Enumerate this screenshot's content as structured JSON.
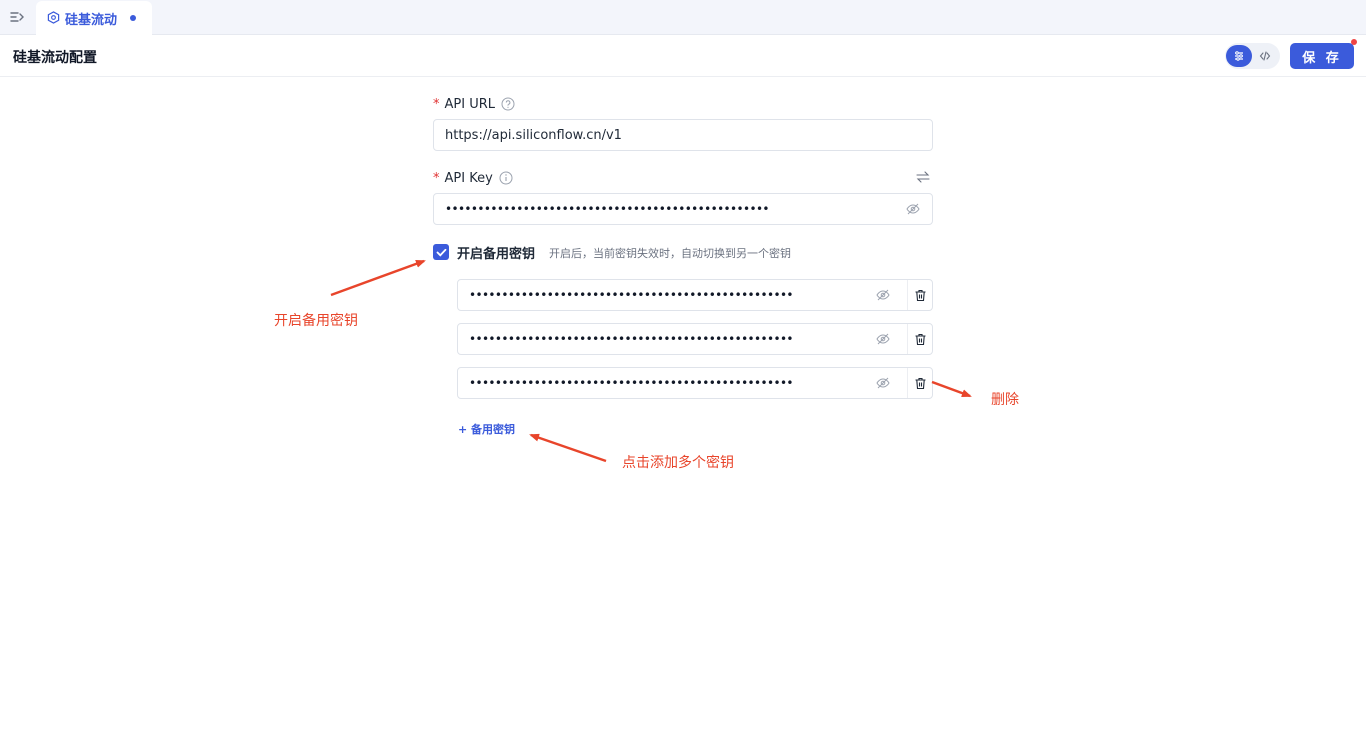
{
  "tab": {
    "label": "硅基流动"
  },
  "header": {
    "title": "硅基流动配置",
    "save_label": "保 存"
  },
  "form": {
    "api_url": {
      "label": "API URL",
      "value": "https://api.siliconflow.cn/v1"
    },
    "api_key": {
      "label": "API Key",
      "masked_value": "••••••••••••••••••••••••••••••••••••••••••••••••••"
    },
    "backup": {
      "checkbox_label": "开启备用密钥",
      "checked": true,
      "hint": "开启后，当前密钥失效时，自动切换到另一个密钥",
      "keys": [
        {
          "masked_value": "••••••••••••••••••••••••••••••••••••••••••••••••••"
        },
        {
          "masked_value": "••••••••••••••••••••••••••••••••••••••••••••••••••"
        },
        {
          "masked_value": "••••••••••••••••••••••••••••••••••••••••••••••••••"
        }
      ],
      "add_label": "+ 备用密钥"
    }
  },
  "annotations": {
    "enable_backup": "开启备用密钥",
    "delete": "删除",
    "add_multiple": "点击添加多个密钥"
  },
  "colors": {
    "accent": "#3b5bdb",
    "annotation": "#e8452b",
    "required": "#e03131"
  }
}
